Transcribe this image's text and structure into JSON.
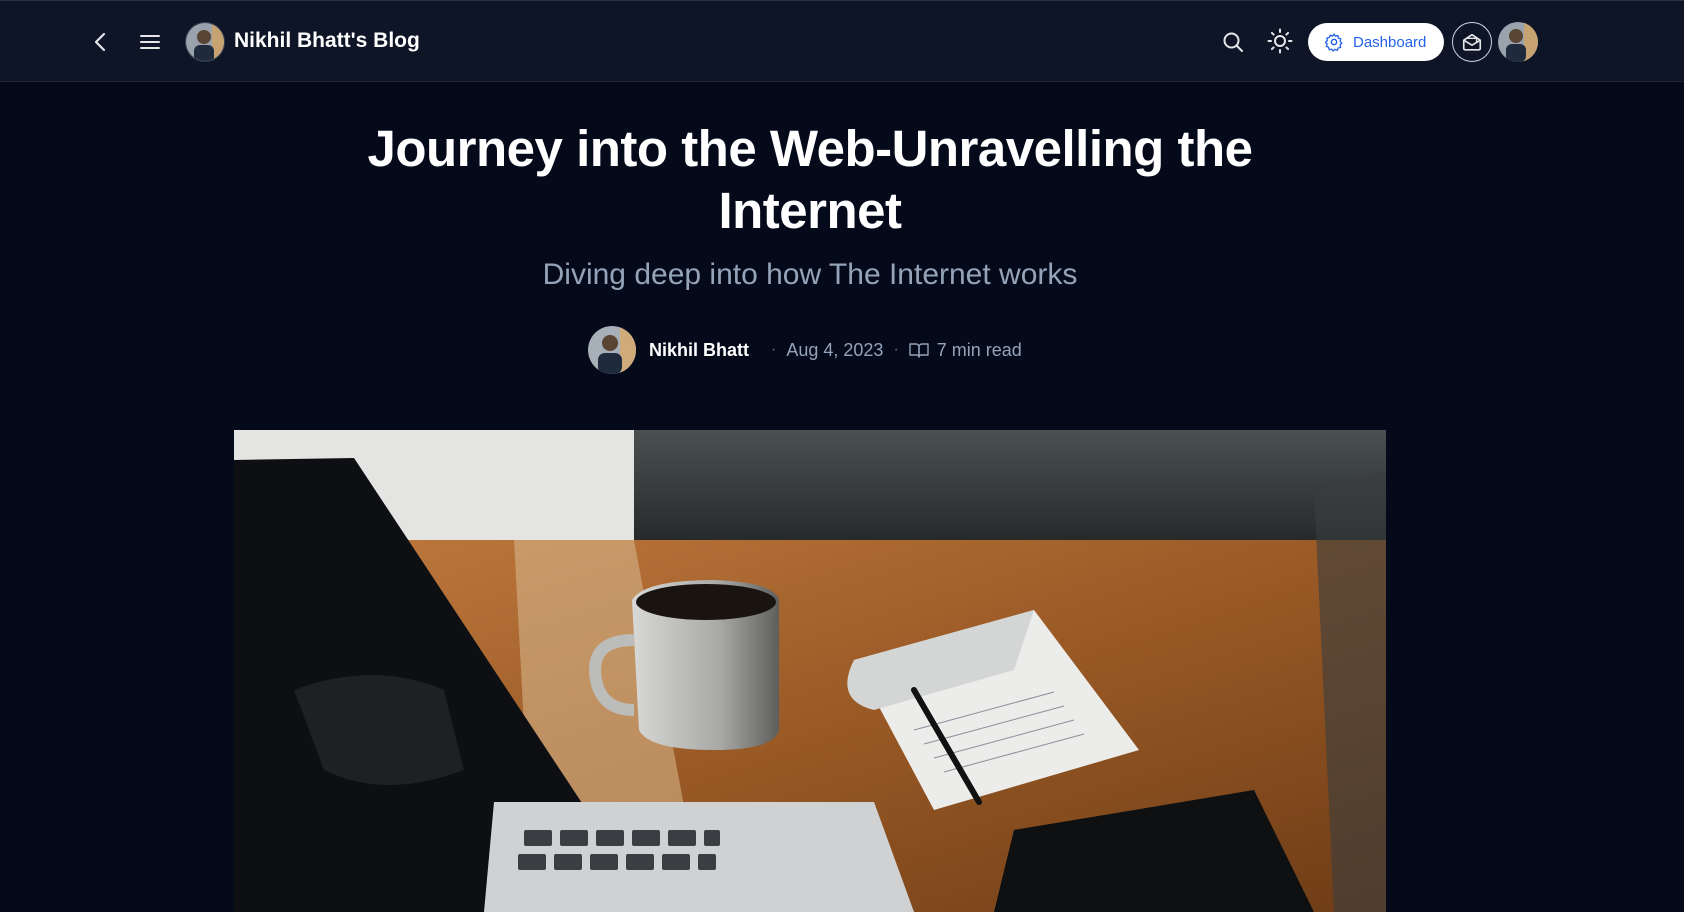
{
  "header": {
    "blog_title": "Nikhil Bhatt's Blog",
    "dashboard_label": "Dashboard"
  },
  "post": {
    "title": "Journey into the Web-Unravelling the Internet",
    "subtitle": "Diving deep into how The Internet works",
    "author": "Nikhil Bhatt",
    "date": "Aug 4, 2023",
    "read_time": "7 min read"
  },
  "icons": {
    "back": "chevron-left-icon",
    "menu": "hamburger-icon",
    "search": "search-icon",
    "theme": "sun-icon",
    "dashboard": "gear-icon",
    "newsletter": "mail-icon",
    "read_time": "book-open-icon"
  },
  "colors": {
    "page_bg": "#050a1b",
    "header_bg": "#0e1527",
    "accent": "#2563eb",
    "muted_text": "#94a3b8"
  }
}
